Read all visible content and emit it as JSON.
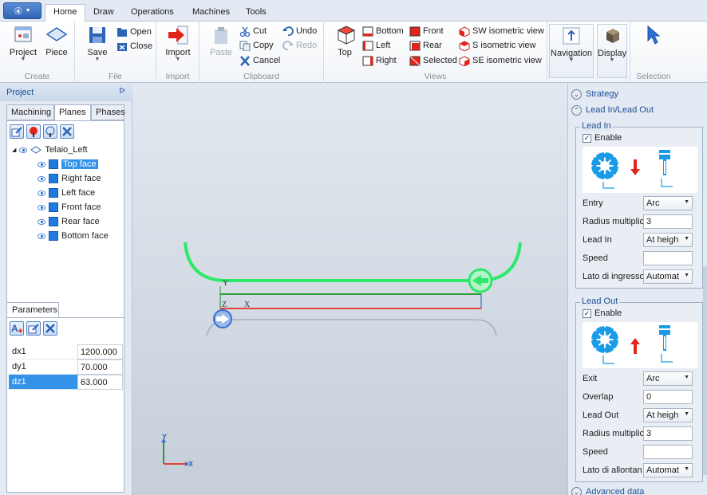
{
  "app_menu": {
    "label": "④"
  },
  "tabs": [
    {
      "label": "Home",
      "active": true
    },
    {
      "label": "Draw"
    },
    {
      "label": "Operations"
    },
    {
      "label": "Machines"
    },
    {
      "label": "Tools"
    }
  ],
  "ribbon": {
    "create": {
      "label": "Create",
      "project": "Project",
      "piece": "Piece"
    },
    "file": {
      "label": "File",
      "save": "Save",
      "open": "Open",
      "close": "Close"
    },
    "import": {
      "label": "Import",
      "import": "Import"
    },
    "clipboard": {
      "label": "Clipboard",
      "paste": "Paste",
      "cut": "Cut",
      "copy": "Copy",
      "cancel": "Cancel",
      "undo": "Undo",
      "redo": "Redo"
    },
    "views": {
      "label": "Views",
      "top": "Top",
      "bottom": "Bottom",
      "left": "Left",
      "right": "Right",
      "front": "Front",
      "rear": "Rear",
      "selected": "Selected",
      "sw": "SW isometric view",
      "s": "S isometric view",
      "se": "SE isometric view"
    },
    "navigation": {
      "label": "Navigation"
    },
    "display": {
      "label": "Display"
    },
    "selection": {
      "label": "Selection"
    }
  },
  "project_panel": {
    "title": "Project",
    "tabs": [
      "Machining",
      "Planes",
      "Phases"
    ],
    "active_tab": "Planes",
    "tree": {
      "root": "Telaio_Left",
      "children": [
        "Top face",
        "Right face",
        "Left face",
        "Front face",
        "Rear face",
        "Bottom face"
      ],
      "selected": "Top face"
    }
  },
  "parameters": {
    "tab": "Parameters",
    "rows": [
      {
        "name": "dx1",
        "value": "1200.000"
      },
      {
        "name": "dy1",
        "value": "70.000"
      },
      {
        "name": "dz1",
        "value": "63.000",
        "selected": true
      }
    ]
  },
  "viewport": {
    "axis_labels": {
      "y": "Y",
      "z": "Z",
      "x": "X"
    },
    "colors": {
      "lead_path": "#2ee86a",
      "piece_red": "#e0443a",
      "piece_green": "#2c9b3a",
      "piece_blue": "#3b6fcf"
    }
  },
  "strategy_panel": {
    "strategy": "Strategy",
    "leadinout": "Lead In/Lead Out",
    "lead_in": {
      "title": "Lead In",
      "enable": "Enable",
      "fields": [
        {
          "label": "Entry",
          "value": "Arc",
          "combo": true
        },
        {
          "label": "Radius multiplic",
          "value": "3",
          "combo": false
        },
        {
          "label": "Lead In",
          "value": "At heigh",
          "combo": true
        },
        {
          "label": "Speed",
          "value": "",
          "combo": false
        },
        {
          "label": "Lato di ingresso",
          "value": "Automat",
          "combo": true
        }
      ]
    },
    "lead_out": {
      "title": "Lead Out",
      "enable": "Enable",
      "fields": [
        {
          "label": "Exit",
          "value": "Arc",
          "combo": true
        },
        {
          "label": "Overlap",
          "value": "0",
          "combo": false
        },
        {
          "label": "Lead Out",
          "value": "At heigh",
          "combo": true
        },
        {
          "label": "Radius multiplic",
          "value": "3",
          "combo": false
        },
        {
          "label": "Speed",
          "value": "",
          "combo": false
        },
        {
          "label": "Lato di allontan",
          "value": "Automat",
          "combo": true
        }
      ]
    },
    "advanced": "Advanced data"
  }
}
